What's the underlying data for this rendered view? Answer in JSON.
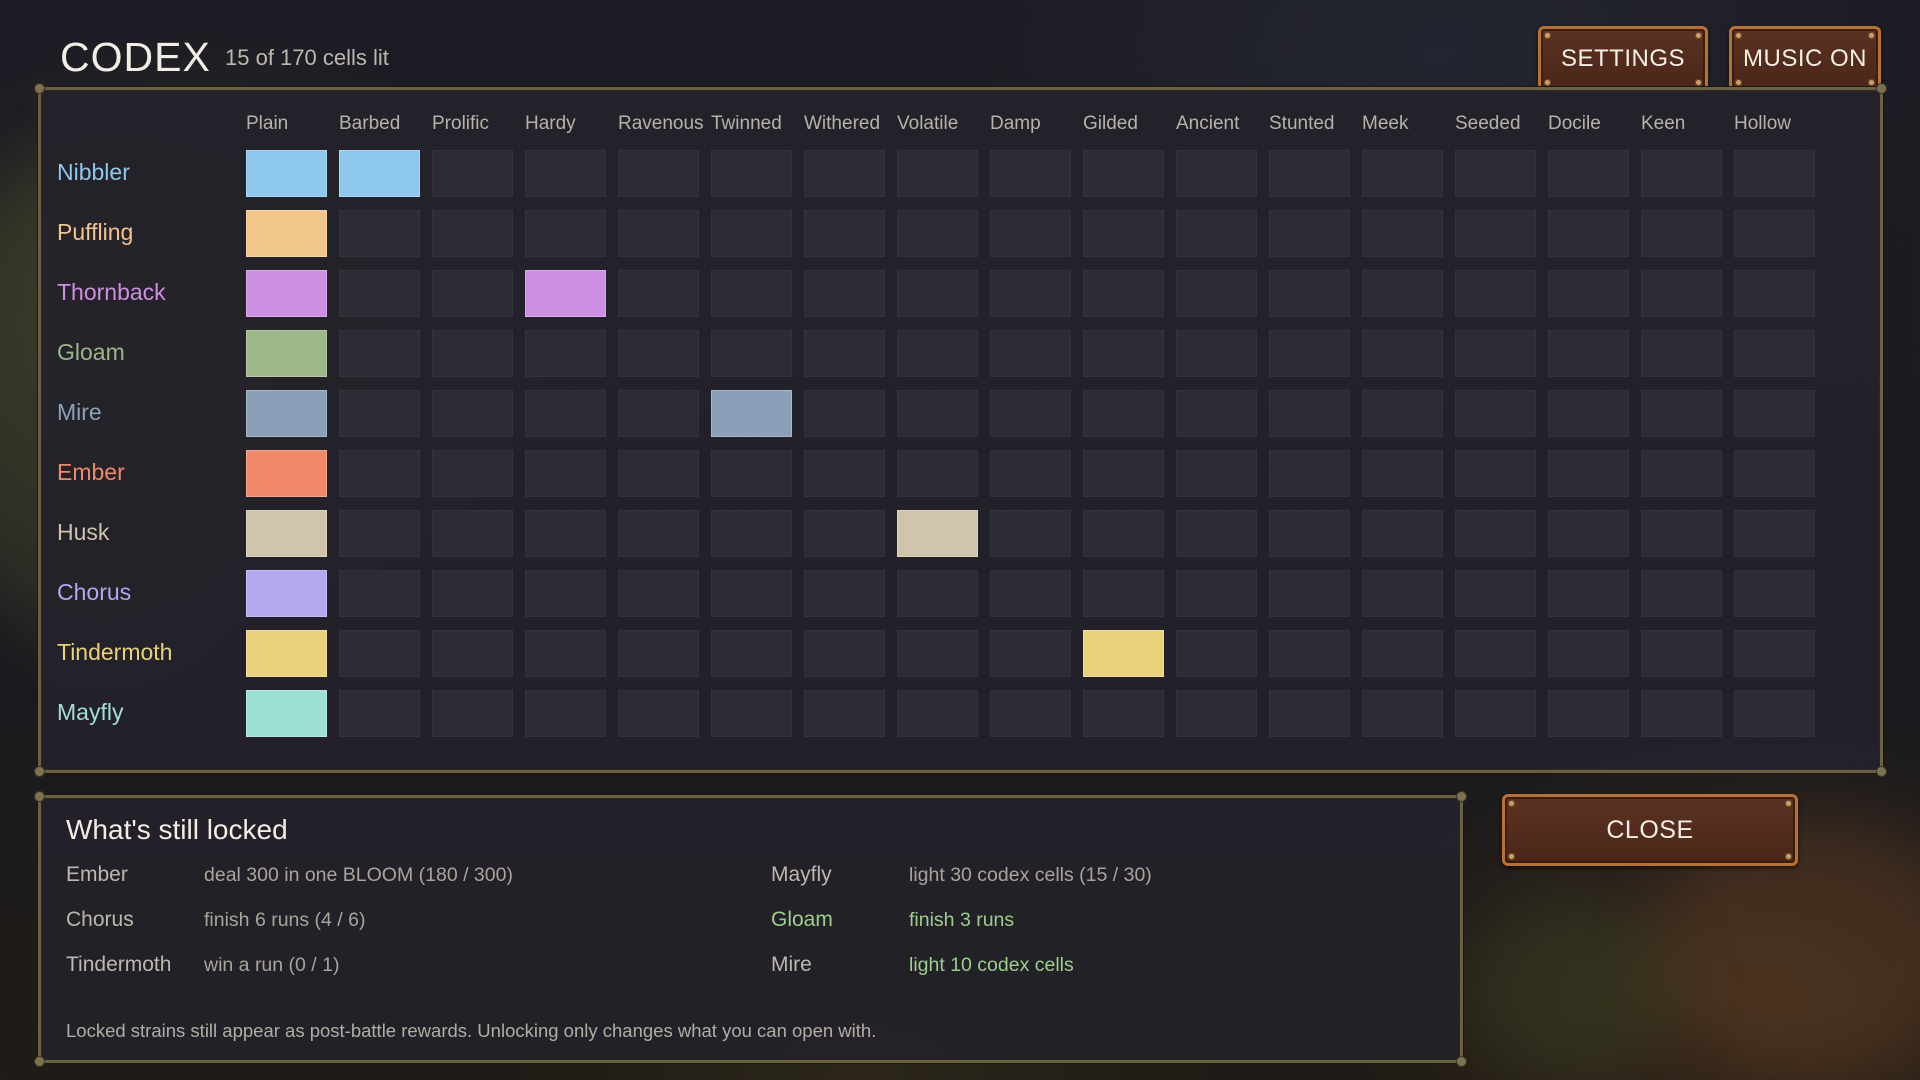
{
  "header": {
    "title": "CODEX",
    "progress": "15 of 170 cells lit",
    "settings_label": "SETTINGS",
    "music_label": "MUSIC ON"
  },
  "codex": {
    "columns": [
      "Plain",
      "Barbed",
      "Prolific",
      "Hardy",
      "Ravenous",
      "Twinned",
      "Withered",
      "Volatile",
      "Damp",
      "Gilded",
      "Ancient",
      "Stunted",
      "Meek",
      "Seeded",
      "Docile",
      "Keen",
      "Hollow"
    ],
    "rows": [
      {
        "name": "Nibbler",
        "color": "#8ec8ec",
        "lit": [
          0,
          1
        ]
      },
      {
        "name": "Puffling",
        "color": "#f2c588",
        "lit": [
          0
        ]
      },
      {
        "name": "Thornback",
        "color": "#cc8fe2",
        "lit": [
          0,
          3
        ]
      },
      {
        "name": "Gloam",
        "color": "#9cb788",
        "lit": [
          0
        ]
      },
      {
        "name": "Mire",
        "color": "#8aa0b8",
        "lit": [
          0,
          5
        ]
      },
      {
        "name": "Ember",
        "color": "#f18869",
        "lit": [
          0
        ]
      },
      {
        "name": "Husk",
        "color": "#d0c4aa",
        "lit": [
          0,
          7
        ]
      },
      {
        "name": "Chorus",
        "color": "#b4a6ef",
        "lit": [
          0
        ]
      },
      {
        "name": "Tindermoth",
        "color": "#e8d27a",
        "lit": [
          0,
          9
        ]
      },
      {
        "name": "Mayfly",
        "color": "#9ee0d2",
        "lit": [
          0
        ]
      }
    ]
  },
  "locked": {
    "title": "What's still locked",
    "left": [
      {
        "name": "Ember",
        "requirement": "deal 300 in one BLOOM (180 / 300)",
        "done": false
      },
      {
        "name": "Chorus",
        "requirement": "finish 6 runs (4 / 6)",
        "done": false
      },
      {
        "name": "Tindermoth",
        "requirement": "win a run (0 / 1)",
        "done": false
      }
    ],
    "right": [
      {
        "name": "Mayfly",
        "requirement": "light 30 codex cells (15 / 30)",
        "done": false
      },
      {
        "name": "Gloam",
        "requirement": "finish 3 runs",
        "done": true,
        "name_color": "#9bcf8a"
      },
      {
        "name": "Mire",
        "requirement": "light 10 codex cells",
        "done": true
      }
    ],
    "footnote": "Locked strains still appear as post-battle rewards. Unlocking only changes what you can open with."
  },
  "close_label": "CLOSE"
}
